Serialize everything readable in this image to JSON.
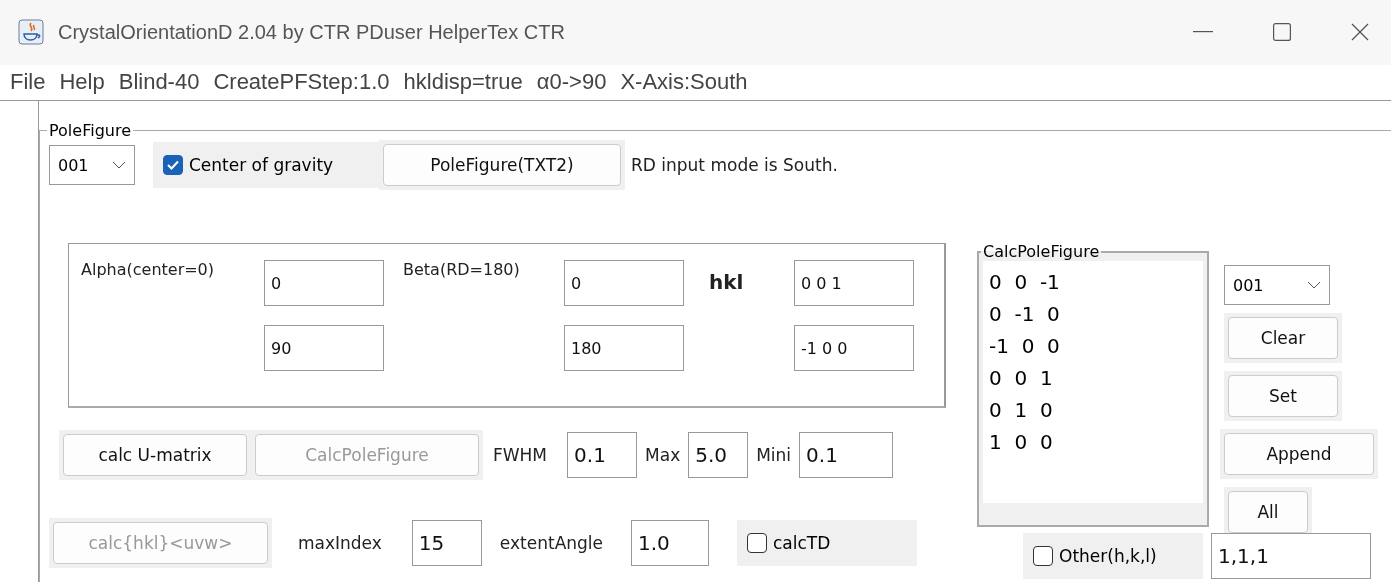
{
  "window": {
    "title": "CrystalOrientationD 2.04 by CTR PDuser HelperTex CTR"
  },
  "menu": [
    "File",
    "Help",
    "Blind-40",
    "CreatePFStep:1.0",
    "hkldisp=true",
    "α0->90",
    "X-Axis:South"
  ],
  "pole_figure": {
    "title": "PoleFigure",
    "combo": "001",
    "center_of_gravity": {
      "label": "Center of gravity",
      "checked": true
    },
    "button": {
      "label": "PoleFigure(TXT2)",
      "disabled": false
    },
    "note": "RD input mode is South."
  },
  "angles": {
    "alpha_label": "Alpha(center=0)",
    "beta_label": "Beta(RD=180)",
    "hkl_label": "hkl",
    "rows": [
      {
        "alpha": "0",
        "beta": "0",
        "hkl": "0 0 1"
      },
      {
        "alpha": "90",
        "beta": "180",
        "hkl": "-1 0 0"
      }
    ]
  },
  "calc_row": {
    "buttons": [
      {
        "label": "calc U-matrix",
        "disabled": false
      },
      {
        "label": "CalcPoleFigure",
        "disabled": true
      }
    ],
    "params": [
      {
        "label": "FWHM",
        "value": "0.1"
      },
      {
        "label": "Max",
        "value": "5.0"
      },
      {
        "label": "Mini",
        "value": "0.1"
      }
    ]
  },
  "bottom_row": {
    "button": {
      "label": "calc{hkl}<uvw>",
      "disabled": true
    },
    "params": [
      {
        "label": "maxIndex",
        "value": "15"
      },
      {
        "label": "extentAngle",
        "value": "1.0"
      }
    ],
    "calc_td": {
      "label": "calcTD",
      "checked": false
    }
  },
  "calc_pole_figure": {
    "title": "CalcPoleFigure",
    "items": [
      "0  0  -1",
      "0  -1  0",
      "-1  0  0",
      "0  0  1",
      "0  1  0",
      "1  0  0"
    ]
  },
  "side": {
    "combo": "001",
    "buttons": [
      {
        "label": "Clear",
        "disabled": false
      },
      {
        "label": "Set",
        "disabled": false
      },
      {
        "label": "Append",
        "disabled": false
      },
      {
        "label": "All",
        "disabled": false
      }
    ],
    "other": {
      "label": "Other(h,k,l)",
      "checked": false
    },
    "other_value": "1,1,1"
  }
}
